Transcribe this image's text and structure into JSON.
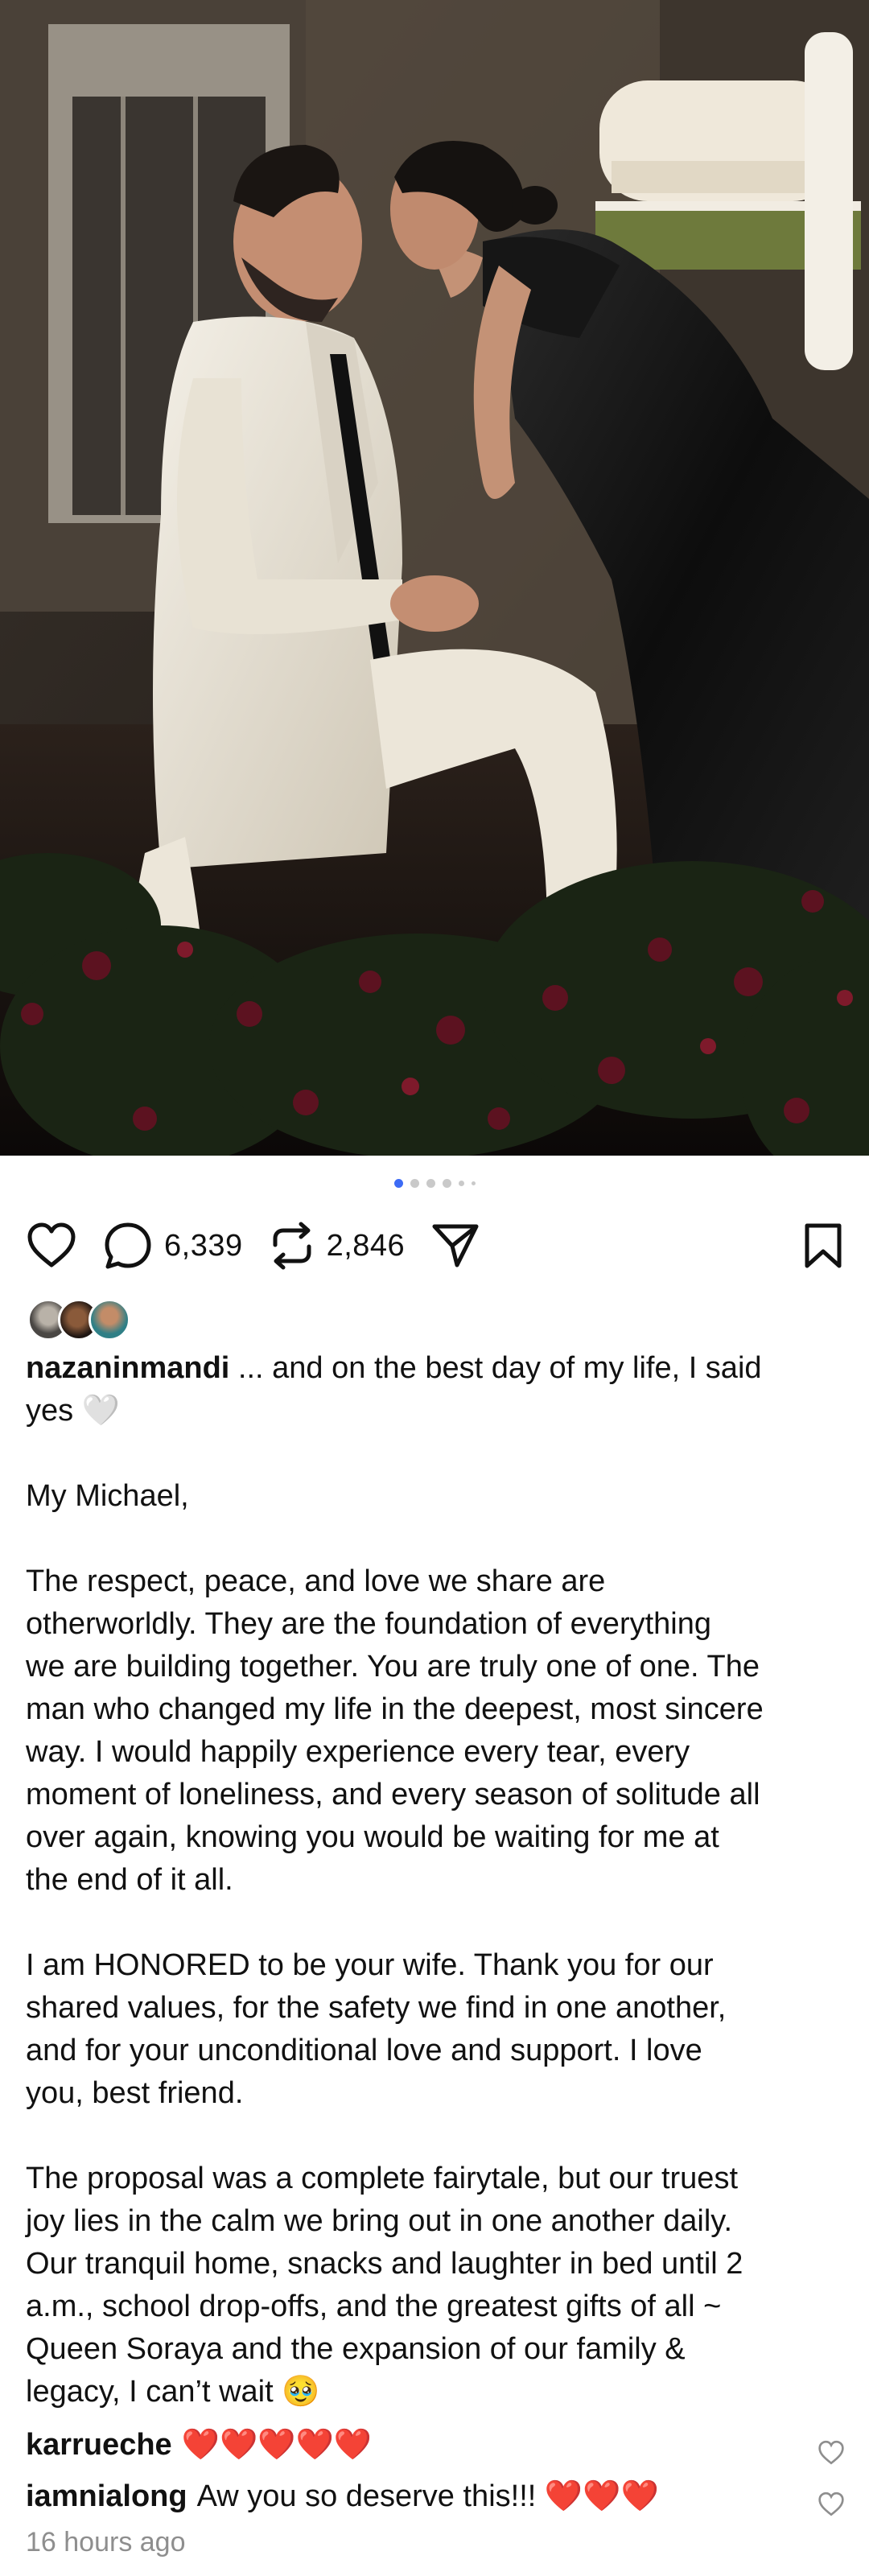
{
  "post": {
    "carousel": {
      "count": 6,
      "active_index": 0
    },
    "actions": {
      "like_icon": "heart-outline-icon",
      "comment_icon": "comment-bubble-icon",
      "comment_count": "6,339",
      "repost_icon": "repost-icon",
      "repost_count": "2,846",
      "share_icon": "paper-plane-icon",
      "save_icon": "bookmark-icon"
    },
    "caption": {
      "username": "nazaninmandi",
      "text": " ... and on the best day of my life, I said\nyes 🤍\n\nMy Michael,\n\nThe respect, peace, and love we share are\notherworldly. They are the foundation of everything\nwe are building together. You are truly one of one. The\nman who changed my life in the deepest, most sincere\nway. I would happily experience every tear, every\nmoment of loneliness, and every season of solitude all\nover again, knowing you would be waiting for me at\nthe end of it all.\n\nI am HONORED to be your wife. Thank you for our\nshared values, for the safety we find in one another,\nand for your unconditional love and support. I love\nyou, best friend.\n\nThe proposal was a complete fairytale, but our truest\njoy lies in the calm we bring out in one another daily.\nOur tranquil home, snacks and laughter in bed until 2\na.m., school drop-offs, and the greatest gifts of all ~\nQueen Soraya and the expansion of our family &\nlegacy, I can’t wait 🥹"
    },
    "comments": [
      {
        "username": "karrueche",
        "text": "❤️❤️❤️❤️❤️"
      },
      {
        "username": "iamnialong",
        "text": "Aw you so deserve this!!! ❤️❤️❤️"
      }
    ],
    "timestamp": "16 hours ago"
  },
  "colors": {
    "accent_dot": "#3d6bf5",
    "text": "#111111",
    "muted": "#8e8e8e"
  }
}
